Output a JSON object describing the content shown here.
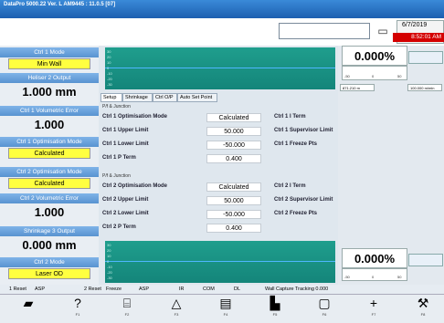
{
  "titlebar": {
    "text": "DataPro 5000.22  Ver. L AM9445 : 11.0.5 [07]"
  },
  "clock": {
    "date": "6/7/2019",
    "time": "8:52:01 AM"
  },
  "left": {
    "items": [
      {
        "label": "Ctrl 1 Mode",
        "value": "Min Wall",
        "style": "yellow"
      },
      {
        "label": "Heliser 2 Output",
        "value": "1.000 mm",
        "style": "big"
      },
      {
        "label": "Ctrl 1 Volumetric Error",
        "value": "1.000",
        "style": "big"
      },
      {
        "label": "Ctrl 1 Optimisation Mode",
        "value": "Calculated",
        "style": "yellow"
      },
      {
        "label": "Ctrl 2 Optimisation Mode",
        "value": "Calculated",
        "style": "yellow"
      },
      {
        "label": "Ctrl 2 Volumetric Error",
        "value": "1.000",
        "style": "big"
      },
      {
        "label": "Shrinkage 3 Output",
        "value": "0.000 mm",
        "style": "big"
      },
      {
        "label": "Ctrl 2 Mode",
        "value": "Laser OD",
        "style": "yellow"
      }
    ]
  },
  "graph": {
    "ticks": [
      "30",
      "20",
      "10",
      "0",
      "-10",
      "-20",
      "-30"
    ]
  },
  "tabs": [
    "Setup",
    "Shrinkage",
    "Ctrl O/P",
    "Auto Set Point"
  ],
  "sections": [
    {
      "title": "P/f & Junction",
      "rows": [
        {
          "l": "Ctrl 1 Optimisation Mode",
          "v": "Calculated",
          "l2": "Ctrl 1 I Term",
          "v2": "0.500"
        },
        {
          "l": "Ctrl 1 Upper Limit",
          "v": "50.000",
          "l2": "Ctrl 1 Supervisor Limit",
          "v2": "100.000"
        },
        {
          "l": "Ctrl 1 Lower Limit",
          "v": "-50.000",
          "l2": "Ctrl 1 Freeze Pts",
          "v2": "B1/735"
        },
        {
          "l": "Ctrl 1 P Term",
          "v": "0.400",
          "l2": "",
          "v2": ""
        }
      ]
    },
    {
      "title": "P/f & Junction",
      "rows": [
        {
          "l": "Ctrl 2 Optimisation Mode",
          "v": "Calculated",
          "l2": "Ctrl 2 I Term",
          "v2": "0.500"
        },
        {
          "l": "Ctrl 2 Upper Limit",
          "v": "50.000",
          "l2": "Ctrl 2 Supervisor Limit",
          "v2": "100.000"
        },
        {
          "l": "Ctrl 2 Lower Limit",
          "v": "-50.000",
          "l2": "Ctrl 2 Freeze Pts",
          "v2": "B1/735"
        },
        {
          "l": "Ctrl 2 P Term",
          "v": "0.400",
          "l2": "",
          "v2": ""
        }
      ]
    }
  ],
  "right": {
    "pct1": "0.000%",
    "pct2": "0.000%",
    "scale": [
      "-50",
      "0",
      "50"
    ],
    "speed_left": "871.210 m",
    "speed_right": "100.000 m/min"
  },
  "status": {
    "items": [
      "1 Reset",
      "ASP",
      "2 Reset",
      "Freeze",
      "ASP",
      "IR",
      "COM",
      "DL",
      "Wall Capture Tracking 0.000"
    ]
  },
  "toolbar": {
    "buttons": [
      {
        "icon": "machine-icon",
        "glyph": "▰",
        "label": ""
      },
      {
        "icon": "help-icon",
        "glyph": "?",
        "label": "F1"
      },
      {
        "icon": "folder-icon",
        "glyph": "⌸",
        "label": "F2"
      },
      {
        "icon": "triangle-icon",
        "glyph": "△",
        "label": "F3"
      },
      {
        "icon": "display-icon",
        "glyph": "▤",
        "label": "F4"
      },
      {
        "icon": "chart-icon",
        "glyph": "▙",
        "label": "F5"
      },
      {
        "icon": "document-icon",
        "glyph": "▢",
        "label": "F6"
      },
      {
        "icon": "plus-icon",
        "glyph": "+",
        "label": "F7"
      },
      {
        "icon": "tools-icon",
        "glyph": "⚒",
        "label": "F8"
      }
    ]
  }
}
